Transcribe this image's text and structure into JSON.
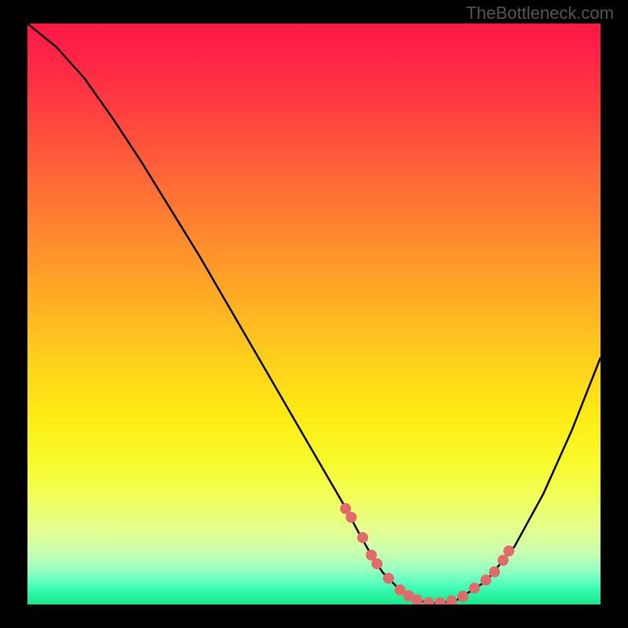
{
  "watermark": "TheBottleneck.com",
  "chart_data": {
    "type": "line",
    "title": "",
    "xlabel": "",
    "ylabel": "",
    "xlim": [
      0,
      100
    ],
    "ylim": [
      0,
      100
    ],
    "curve": {
      "name": "bottleneck-curve",
      "color": "#000000",
      "x": [
        0,
        5,
        10,
        15,
        20,
        25,
        30,
        35,
        40,
        45,
        50,
        55,
        58,
        60,
        62,
        65,
        68,
        70,
        72,
        75,
        80,
        85,
        90,
        95,
        100
      ],
      "y": [
        100,
        96,
        90.5,
        83.5,
        76,
        68,
        60,
        51.5,
        43,
        34.5,
        26,
        17.5,
        12,
        8.5,
        5.5,
        2.5,
        0.8,
        0.2,
        0.2,
        0.8,
        4,
        10,
        19,
        30,
        42.5
      ]
    },
    "marker_points": {
      "name": "highlight-dots",
      "color": "#e26a6a",
      "radius": 7,
      "x": [
        55.5,
        56.5,
        58.5,
        60,
        61,
        63,
        65,
        66.5,
        68,
        70,
        72,
        74,
        76,
        78,
        80,
        81.5,
        83,
        84
      ],
      "y": [
        16.5,
        15,
        11.5,
        8.5,
        7,
        4.5,
        2.5,
        1.5,
        0.8,
        0.3,
        0.3,
        0.6,
        1.4,
        2.8,
        4.2,
        5.6,
        7.6,
        9.2
      ]
    },
    "gradient_description": "vertical red-to-green representing bottleneck severity"
  }
}
